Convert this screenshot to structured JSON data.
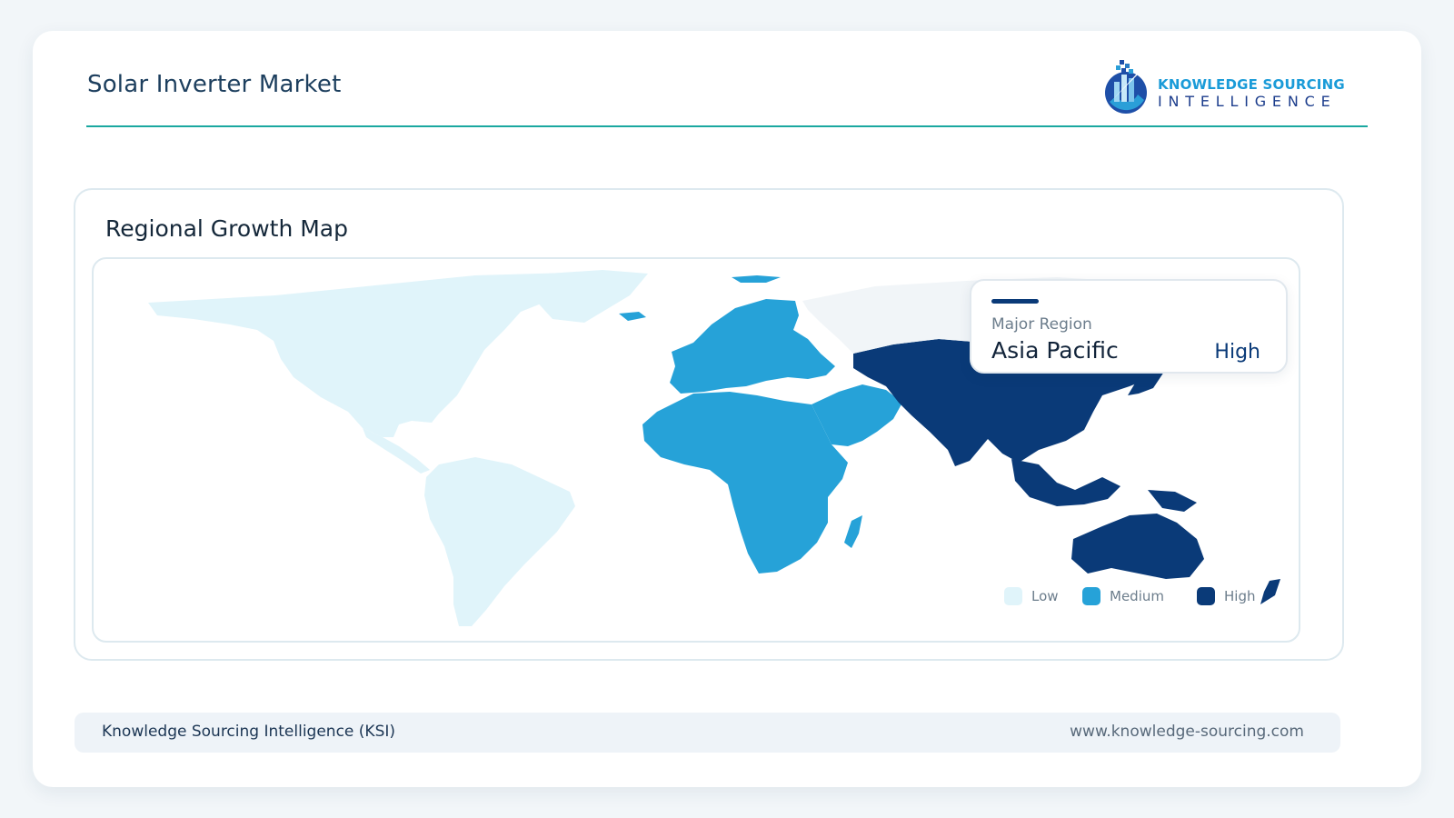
{
  "header": {
    "title": "Solar Inverter Market",
    "logo_text_line1": "KNOWLEDGE SOURCING",
    "logo_text_line2": "INTELLIGENCE"
  },
  "map_panel": {
    "title": "Regional Growth Map"
  },
  "callout": {
    "label": "Major Region",
    "region": "Asia Pacific",
    "level": "High"
  },
  "legend": [
    {
      "label": "Low",
      "color": "#e0f4fa"
    },
    {
      "label": "Medium",
      "color": "#26a2d8"
    },
    {
      "label": "High",
      "color": "#0a3a78"
    }
  ],
  "regions": [
    {
      "name": "North America",
      "level": "Low"
    },
    {
      "name": "South America",
      "level": "Low"
    },
    {
      "name": "Europe",
      "level": "Medium"
    },
    {
      "name": "Middle East and Africa",
      "level": "Medium"
    },
    {
      "name": "Asia Pacific",
      "level": "High"
    }
  ],
  "colors": {
    "low": "#e0f4fa",
    "medium": "#26a2d8",
    "high": "#0a3a78",
    "accent_rule": "#1aa8a0"
  },
  "footer": {
    "left": "Knowledge Sourcing Intelligence (KSI)",
    "right": "www.knowledge-sourcing.com"
  }
}
